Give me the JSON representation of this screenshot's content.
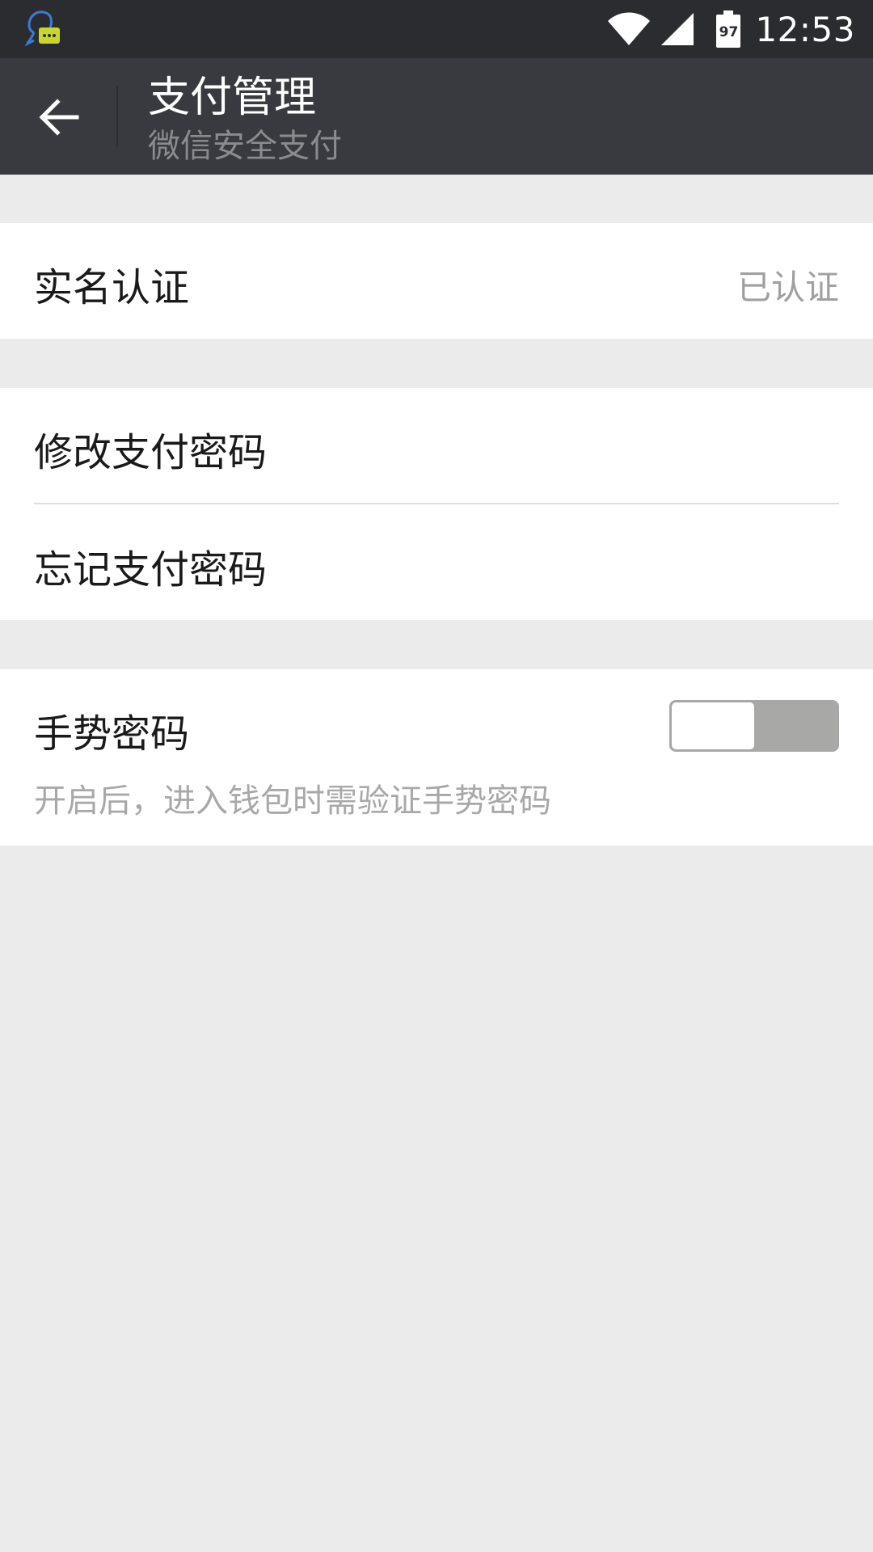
{
  "status_bar": {
    "time": "12:53",
    "battery_level": "97",
    "icons": [
      "qq-notification-icon",
      "wifi-icon",
      "cell-signal-icon",
      "battery-icon"
    ]
  },
  "header": {
    "title": "支付管理",
    "subtitle": "微信安全支付",
    "back_icon": "arrow-left-icon"
  },
  "sections": {
    "verification": {
      "label": "实名认证",
      "value": "已认证"
    },
    "password": {
      "change_label": "修改支付密码",
      "forgot_label": "忘记支付密码"
    },
    "gesture": {
      "label": "手势密码",
      "description": "开启后，进入钱包时需验证手势密码",
      "enabled": false
    }
  },
  "colors": {
    "status_bar_bg": "#2b2c30",
    "title_bar_bg": "#393a3f",
    "page_bg": "#ebebeb",
    "card_bg": "#ffffff",
    "secondary_text": "#a0a0a0"
  }
}
